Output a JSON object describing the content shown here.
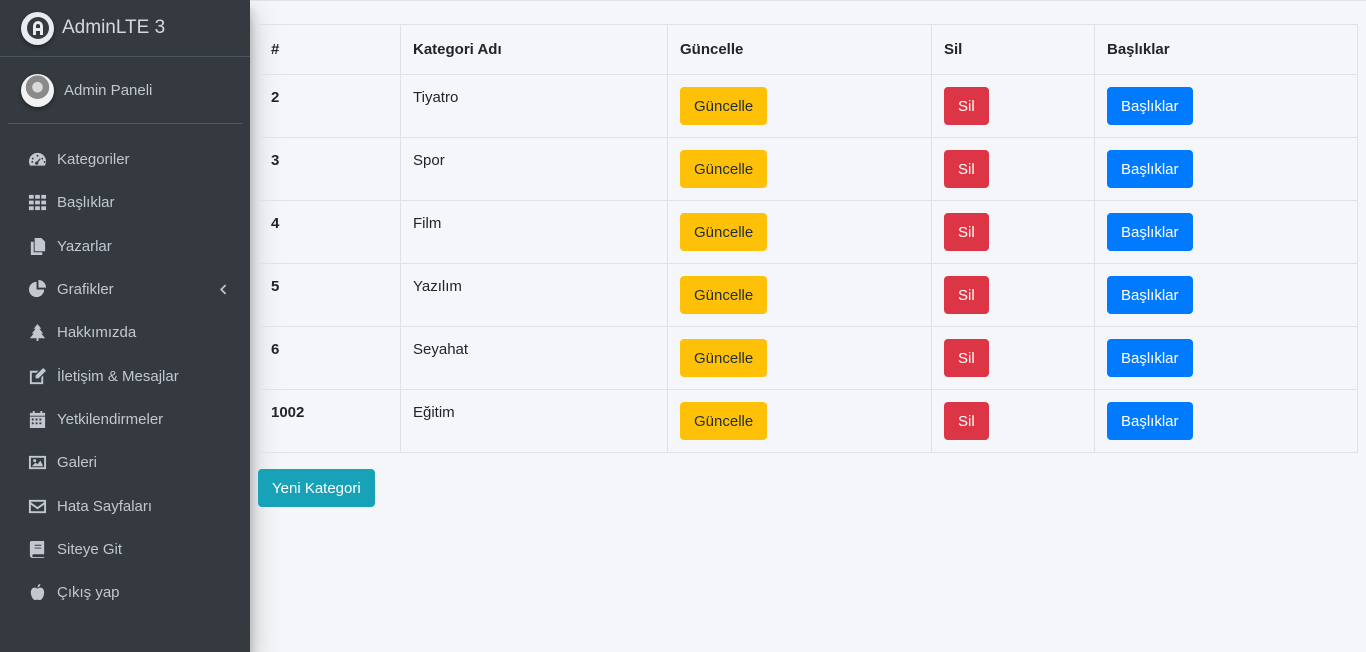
{
  "brand": {
    "title": "AdminLTE 3",
    "logo_icon": "adminlte-logo-icon"
  },
  "user": {
    "name": "Admin Paneli"
  },
  "sidebar": {
    "items": [
      {
        "label": "Kategoriler",
        "icon": "tachometer-icon"
      },
      {
        "label": "Başlıklar",
        "icon": "grid-icon"
      },
      {
        "label": "Yazarlar",
        "icon": "copy-icon"
      },
      {
        "label": "Grafikler",
        "icon": "pie-chart-icon"
      },
      {
        "label": "Hakkımızda",
        "icon": "tree-icon"
      },
      {
        "label": "İletişim & Mesajlar",
        "icon": "edit-icon"
      },
      {
        "label": "Yetkilendirmeler",
        "icon": "calendar-icon"
      },
      {
        "label": "Galeri",
        "icon": "image-icon"
      },
      {
        "label": "Hata Sayfaları",
        "icon": "envelope-icon"
      },
      {
        "label": "Siteye Git",
        "icon": "book-icon"
      },
      {
        "label": "Çıkış yap",
        "icon": "apple-icon"
      }
    ]
  },
  "table": {
    "headers": [
      "#",
      "Kategori Adı",
      "Güncelle",
      "Sil",
      "Başlıklar"
    ],
    "rows": [
      {
        "id": "2",
        "name": "Tiyatro",
        "update": "Güncelle",
        "delete": "Sil",
        "titles": "Başlıklar"
      },
      {
        "id": "3",
        "name": "Spor",
        "update": "Güncelle",
        "delete": "Sil",
        "titles": "Başlıklar"
      },
      {
        "id": "4",
        "name": "Film",
        "update": "Güncelle",
        "delete": "Sil",
        "titles": "Başlıklar"
      },
      {
        "id": "5",
        "name": "Yazılım",
        "update": "Güncelle",
        "delete": "Sil",
        "titles": "Başlıklar"
      },
      {
        "id": "6",
        "name": "Seyahat",
        "update": "Güncelle",
        "delete": "Sil",
        "titles": "Başlıklar"
      },
      {
        "id": "1002",
        "name": "Eğitim",
        "update": "Güncelle",
        "delete": "Sil",
        "titles": "Başlıklar"
      }
    ]
  },
  "new_category_label": "Yeni Kategori",
  "colors": {
    "sidebar_bg": "#343a40",
    "warning": "#ffc107",
    "danger": "#dc3545",
    "primary": "#007bff",
    "info": "#17a2b8"
  }
}
